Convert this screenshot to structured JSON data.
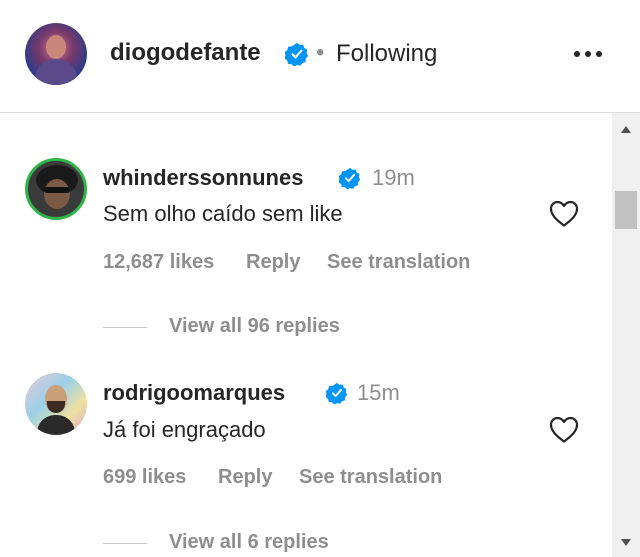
{
  "header": {
    "username": "diogodefante",
    "separator": "•",
    "follow_status": "Following",
    "avatar_icon": "profile-avatar",
    "more_icon": "more-options-icon"
  },
  "colors": {
    "verified_blue": "#0095f6",
    "muted_text": "#8e8e8e",
    "primary_text": "#262626",
    "story_ring": "#2fb64a"
  },
  "comments": [
    {
      "username": "whinderssonnunes",
      "time": "19m",
      "text": "Sem olho caído sem like",
      "likes": "12,687 likes",
      "reply_label": "Reply",
      "translation_label": "See translation",
      "view_replies": "View all 96 replies"
    },
    {
      "username": "rodrigoomarques",
      "time": "15m",
      "text": "Já foi engraçado",
      "likes": "699 likes",
      "reply_label": "Reply",
      "translation_label": "See translation",
      "view_replies": "View all 6 replies"
    }
  ]
}
